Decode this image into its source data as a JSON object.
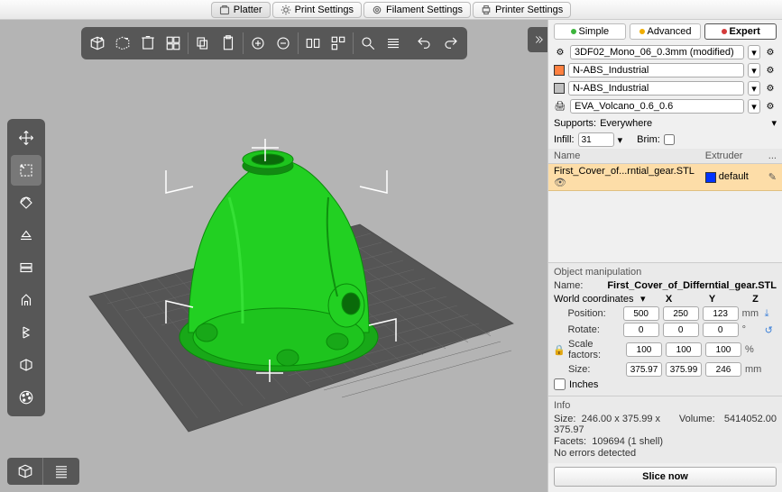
{
  "tabs": {
    "platter": "Platter",
    "print": "Print Settings",
    "filament": "Filament Settings",
    "printer": "Printer Settings"
  },
  "modes": {
    "simple": "Simple",
    "advanced": "Advanced",
    "expert": "Expert"
  },
  "presets": {
    "print": "3DF02_Mono_06_0.3mm (modified)",
    "filament1": "N-ABS_Industrial",
    "filament2": "N-ABS_Industrial",
    "printer": "EVA_Volcano_0.6_0.6"
  },
  "options": {
    "supports_label": "Supports:",
    "supports_value": "Everywhere",
    "infill_label": "Infill:",
    "infill_value": "31",
    "brim_label": "Brim:"
  },
  "table": {
    "col_name": "Name",
    "col_extruder": "Extruder",
    "col_edit": "...",
    "row_name": "First_Cover_of...rntial_gear.STL",
    "row_extruder": "default"
  },
  "om": {
    "title": "Object manipulation",
    "name_label": "Name:",
    "name_value": "First_Cover_of_Differntial_gear.STL",
    "coord_mode": "World coordinates",
    "x": "X",
    "y": "Y",
    "z": "Z",
    "position_label": "Position:",
    "pos": [
      "500",
      "250",
      "123"
    ],
    "pos_unit": "mm",
    "rotate_label": "Rotate:",
    "rot": [
      "0",
      "0",
      "0"
    ],
    "rot_unit": "°",
    "scale_label": "Scale factors:",
    "scale": [
      "100",
      "100",
      "100"
    ],
    "scale_unit": "%",
    "size_label": "Size:",
    "size": [
      "375.97",
      "375.99",
      "246"
    ],
    "size_unit": "mm",
    "inches_label": "Inches"
  },
  "info": {
    "title": "Info",
    "size_label": "Size:",
    "size_value": "246.00 x 375.99 x 375.97",
    "volume_label": "Volume:",
    "volume_value": "5414052.00",
    "facets_label": "Facets:",
    "facets_value": "109694 (1 shell)",
    "errors": "No errors detected"
  },
  "slice": "Slice now",
  "colors": {
    "simple_dot": "#3db53d",
    "advanced_dot": "#f0ad00",
    "expert_dot": "#d43a3a",
    "swatch1": "#ff8040",
    "swatch2": "#c0c0c0",
    "extruder": "#0033ff"
  },
  "chart_data": {
    "type": "3d-model",
    "object": "First_Cover_of_Differntial_gear.STL",
    "color": "#1ec41e"
  }
}
